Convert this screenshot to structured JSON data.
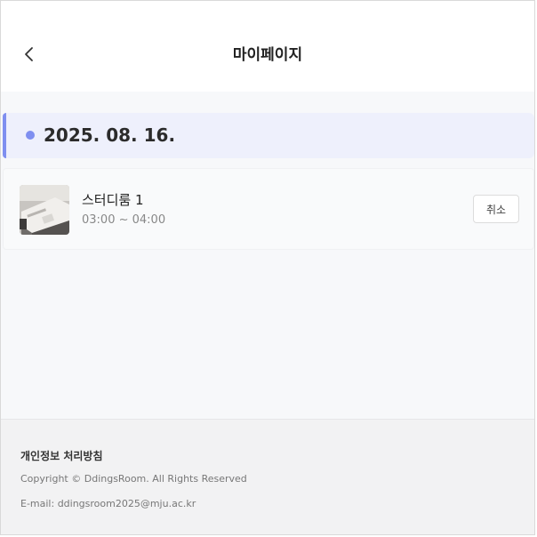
{
  "header": {
    "title": "마이페이지"
  },
  "reservation": {
    "date": "2025. 08. 16.",
    "room_name": "스터디룸 1",
    "time": "03:00 ~ 04:00",
    "cancel_label": "취소"
  },
  "footer": {
    "privacy": "개인정보 처리방침",
    "copyright": "Copyright © DdingsRoom. All Rights Reserved",
    "email": "E-mail: ddingsroom2025@mju.ac.kr"
  },
  "colors": {
    "accent": "#7f8ff0",
    "banner_bg": "#eef0fc"
  },
  "icons": {
    "back": "chevron-left-icon"
  }
}
